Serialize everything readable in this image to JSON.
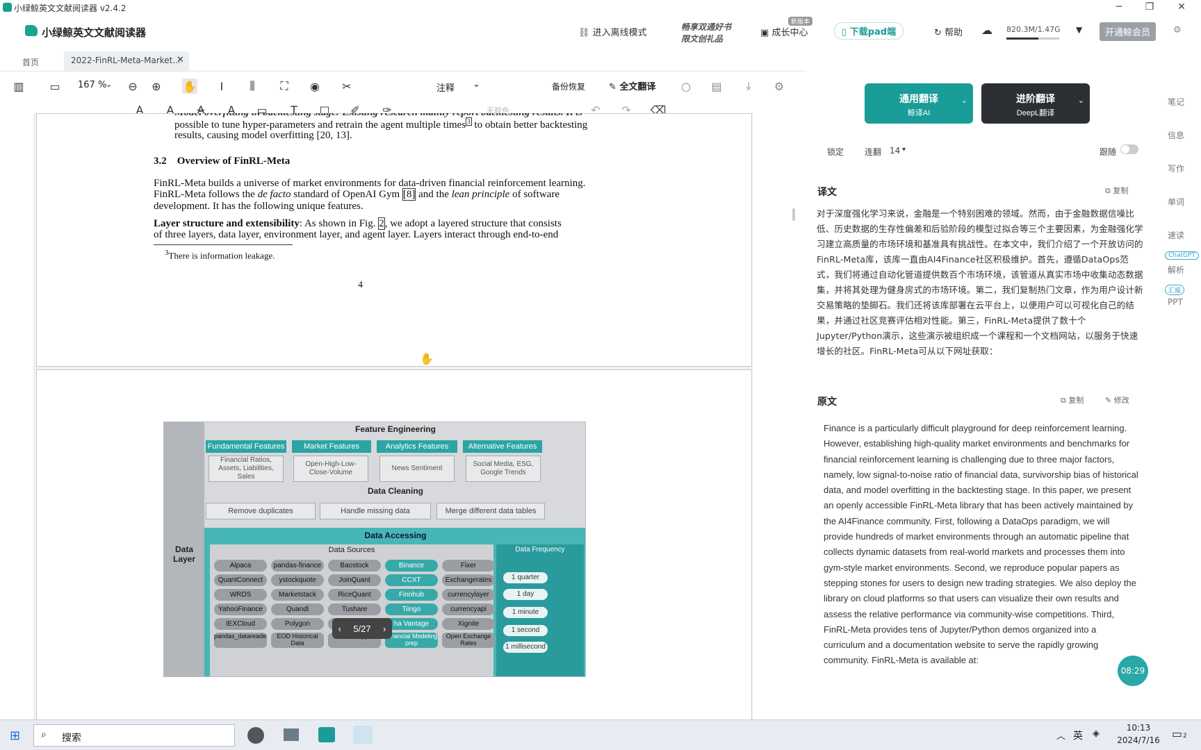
{
  "window": {
    "title": "小绿鲸英文文献阅读器 v2.4.2"
  },
  "brand": {
    "name": "小绿鲸英文文献阅读器"
  },
  "topbar": {
    "offline": "进入离线模式",
    "promo": "畅享双通好书",
    "promo2": "限文创礼品",
    "growth": "成长中心",
    "growth_badge": "新版本",
    "download_pad": "下载pad端",
    "help": "帮助",
    "storage": "820.3M/1.47G",
    "vip": "开通鲸会员"
  },
  "tabs": [
    {
      "label": "首页"
    },
    {
      "label": "2022-FinRL-Meta-Market..."
    }
  ],
  "toolbar": {
    "zoom": "167 %",
    "annotate": "注释",
    "backup": "备份恢复",
    "full_translate": "全文翻译",
    "no_color": "无颜色"
  },
  "paper": {
    "line0": "Model overfitting in backtesting stage: Existing research mainly report backtesting results. It is",
    "line1": "possible to tune hyper-parameters and retrain the agent multiple times",
    "line1b": "3",
    "line1c": "to obtain better backtesting",
    "line2": "results, causing model overfitting",
    "line2b": "[20, 13].",
    "section": "3.2    Overview of FinRL-Meta",
    "p1": "FinRL-Meta builds a universe of market environments for data-driven financial reinforcement learning.",
    "p2a": "FinRL-Meta follows the",
    "p2b": "de facto",
    "p2c": "standard of OpenAI Gym",
    "p2d": "[8]",
    "p2e": "and the",
    "p2f": "lean principle",
    "p2g": "of software",
    "p3": "development. It has the following unique features.",
    "p4a": "Layer structure and extensibility",
    "p4b": ": As shown in Fig.",
    "p4c": "2",
    "p4d": ", we adopt a layered structure that consists",
    "p5": "of three layers, data layer, environment layer, and agent layer. Layers interact through end-to-end",
    "footnote": "There is information leakage.",
    "footnote_mark": "3",
    "page_number": "4"
  },
  "figure": {
    "left_label": "Data Layer",
    "feature_eng": "Feature Engineering",
    "features": [
      "Fundamental Features",
      "Market Features",
      "Analytics Features",
      "Alternative Features"
    ],
    "feature_desc": [
      "Financial Ratios, Assets, Liabilities, Sales",
      "Open-High-Low-Close-Volume",
      "News Sentiment",
      "Social Media, ESG, Google Trends"
    ],
    "cleaning": "Data Cleaning",
    "cleaning_items": [
      "Remove duplicates",
      "Handle missing data",
      "Merge different data tables"
    ],
    "accessing": "Data Accessing",
    "sources_head": "Data Sources",
    "sources": [
      [
        "Alpaca",
        "pandas-finance",
        "Baostock",
        "Binance",
        "Fixer"
      ],
      [
        "QuantConnect",
        "ystockquote",
        "JoinQuant",
        "CCXT",
        "Exchangerates"
      ],
      [
        "WRDS",
        "Marketstack",
        "RiceQuant",
        "Finnhub",
        "currencylayer"
      ],
      [
        "YahooFinance",
        "Quandl",
        "Tushare",
        "Tiingo",
        "currencyapi"
      ],
      [
        "IEXCloud",
        "Polygon",
        "",
        "ha Vantage",
        "Xignite"
      ],
      [
        "pandas_datareader",
        "EOD Historical Data",
        "Findatapy",
        "Financial Modeling prep",
        "Open Exchange Rates"
      ]
    ],
    "freq_head": "Data Frequency",
    "freqs": [
      "1 quarter",
      "1 day",
      "1 minute",
      "1 second",
      "1 millisecond"
    ]
  },
  "pager": {
    "label": "5/27"
  },
  "right": {
    "btn_general": "通用翻译",
    "btn_general_sub": "鲸译AI",
    "btn_adv": "进阶翻译",
    "btn_adv_sub": "DeepL翻译",
    "lock": "锁定",
    "font": "连翻",
    "font_size": "14",
    "follow": "跟随",
    "trans_title": "译文",
    "copy": "复制",
    "translation": "对于深度强化学习来说，金融是一个特别困难的领域。然而，由于金融数据信噪比低、历史数据的生存性偏差和后验阶段的模型过拟合等三个主要因素，为金融强化学习建立高质量的市场环境和基准具有挑战性。在本文中，我们介绍了一个开放访问的FinRL-Meta库，该库一直由AI4Finance社区积极维护。首先，遵循DataOps范式，我们将通过自动化管道提供数百个市场环境，该管道从真实市场中收集动态数据集，并将其处理为健身房式的市场环境。第二，我们复制热门文章，作为用户设计新交易策略的垫脚石。我们还将该库部署在云平台上，以便用户可以可视化自己的结果，并通过社区竞赛评估相对性能。第三，FinRL-Meta提供了数十个Jupyter/Python演示，这些演示被组织成一个课程和一个文档网站，以服务于快速增长的社区。FinRL-Meta可从以下网址获取：",
    "orig_title": "原文",
    "copy2": "复制",
    "edit": "修改",
    "original": "Finance is a particularly difficult playground for deep reinforcement learning. However, establishing high-quality market environments and benchmarks for financial reinforcement learning is challenging due to three major factors, namely, low signal-to-noise ratio of financial data, survivorship bias of historical data, and model overfitting in the backtesting stage. In this paper, we present an openly accessible FinRL-Meta library that has been actively maintained by the AI4Finance community. First, following a DataOps paradigm, we will provide hundreds of market environments through an automatic pipeline that collects dynamic datasets from real-world markets and processes them into gym-style market environments. Second, we reproduce popular papers as stepping stones for users to design new trading strategies. We also deploy the library on cloud platforms so that users can visualize their own results and assess the relative performance via community-wise competitions. Third, FinRL-Meta provides tens of Jupyter/Python demos organized into a curriculum and a documentation website to serve the rapidly growing community. FinRL-Meta is available at:",
    "timer": "08:29"
  },
  "sidebar": [
    "笔记",
    "信息",
    "写作",
    "单词",
    "速读",
    "ChatGPT",
    "解析",
    "汇报",
    "PPT"
  ],
  "taskbar": {
    "search": "搜索",
    "lang": "英",
    "time": "10:13",
    "date": "2024/7/16",
    "notif": "2"
  },
  "colors": {
    "accent": "#1a9c98",
    "dark_btn": "#2b2f33"
  }
}
